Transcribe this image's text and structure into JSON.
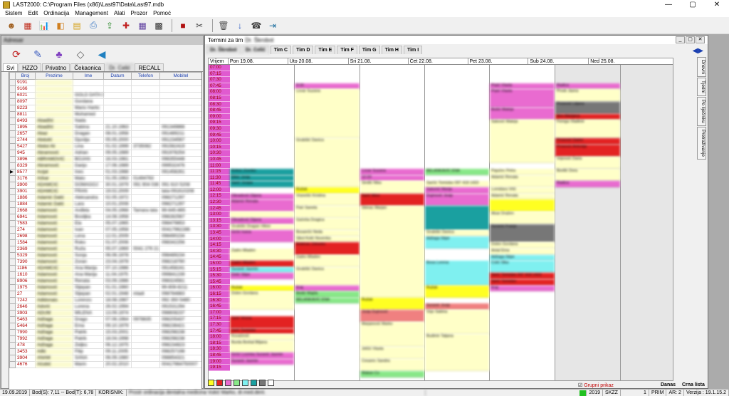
{
  "window": {
    "title": "LAST2000: C:\\Program Files (x86)\\Last97\\Data\\Last97.mdb",
    "min": "—",
    "max": "▢",
    "close": "✕"
  },
  "menu": [
    "Sistem",
    "Edit",
    "Ordinacija",
    "Management",
    "Alati",
    "Prozor",
    "Pomoć"
  ],
  "left": {
    "title": "Adresar",
    "tabs": [
      "Svi",
      "HZZO",
      "Privatno",
      "Čekaonica",
      "Dr. Celić",
      "RECALL"
    ],
    "columns": [
      "Broj",
      "Prezime",
      "Ime",
      "Datum",
      "Telefon",
      "Mobitel"
    ],
    "rows": [
      [
        "9191",
        "",
        "",
        "",
        "",
        ""
      ],
      [
        "9166",
        "",
        "",
        "",
        "",
        ""
      ],
      [
        "6021",
        "",
        "GOLD DATA D",
        "",
        "",
        ""
      ],
      [
        "8097",
        "",
        "Gordana",
        "",
        "",
        ""
      ],
      [
        "8223",
        "",
        "Mario Hartic",
        "",
        "",
        ""
      ],
      [
        "8811",
        "",
        "Muhamed",
        "",
        "",
        ""
      ],
      [
        "8493",
        "Abadžić",
        "Nada",
        "",
        "",
        ""
      ],
      [
        "1895",
        "Abadžić",
        "Sabina",
        "21.10.1963",
        "",
        "091349866"
      ],
      [
        "2657",
        "Abaz",
        "Dragan",
        "08.01.1958",
        "",
        "091489211"
      ],
      [
        "2744",
        "Abdulić",
        "Djurdja",
        "05.05.2000",
        "",
        "091234567"
      ],
      [
        "5427",
        "Abdul Ali",
        "Lina",
        "01.02.1999",
        "3735082",
        "091562419"
      ],
      [
        "945",
        "Abramović",
        "Adrian",
        "09.05.1989",
        "",
        "091978254"
      ],
      [
        "3896",
        "ABRAMOVIĆ",
        "BOJAN",
        "16.03.1981",
        "",
        "098355448"
      ],
      [
        "8329",
        "Abramović",
        "Darijo",
        "17.06.1989",
        "",
        "099532476"
      ],
      [
        "8577",
        "Acijal",
        "Ines",
        "01.03.1988",
        "",
        "091458261"
      ],
      [
        "3176",
        "Ačkar",
        "Mato",
        "01.05.1963",
        "01494763",
        ""
      ],
      [
        "3900",
        "ADAMČIĆ",
        "DOMAGOJ",
        "30.01.1979",
        "091 904 036",
        "091 610 5208"
      ],
      [
        "3901",
        "ADAMČIĆ",
        "FRAN",
        "19.02.2009",
        "",
        "tata-091610208"
      ],
      [
        "1886",
        "Adamić Dalić",
        "Aleksandra",
        "02.05.1972",
        "",
        "098271297"
      ],
      [
        "1884",
        "Adamić Dalić",
        "Lara",
        "10.01.2008",
        "",
        "098271297"
      ],
      [
        "2668",
        "Adamović",
        "Anđela",
        "04.05.1968",
        "Tamara tata",
        "99-645-865"
      ],
      [
        "6941",
        "Adamović",
        "Bosiljka",
        "14.08.1958",
        "",
        "098282567"
      ],
      [
        "7583",
        "Adamović",
        "Ela",
        "05.07.1965",
        "",
        "098479853"
      ],
      [
        "274",
        "Adamović",
        "Ivan",
        "07.05.1958",
        "",
        "00417962286"
      ],
      [
        "2698",
        "Adamović",
        "Lena",
        "12.01.2009",
        "",
        "098490234"
      ],
      [
        "1584",
        "Adamović",
        "Roko",
        "01.07.2006",
        "",
        "098342256"
      ],
      [
        "2369",
        "Adamović",
        "Ruža",
        "05.07.1969",
        "0041 279 21",
        ""
      ],
      [
        "5329",
        "Adamović",
        "Sonja",
        "06.06.1978",
        "",
        "098489234"
      ],
      [
        "7390",
        "Adamović",
        "Zoran",
        "23.04.1978",
        "",
        "098218790"
      ],
      [
        "1186",
        "ADAMČIĆ",
        "Ana Marija",
        "07.10.1986",
        "",
        "091458241"
      ],
      [
        "1610",
        "Adamović",
        "Ana Marija",
        "11.04.1975",
        "",
        "099841239"
      ],
      [
        "8906",
        "Adamović",
        "Renata",
        "03.09.1986",
        "",
        "098324561"
      ],
      [
        "1975",
        "Adamović",
        "Stjepan",
        "01.01.1960",
        "",
        "99-808-8211"
      ],
      [
        "27",
        "Adamović",
        "Stjepan",
        "02.01.1948",
        "mladi",
        "098784883"
      ],
      [
        "7242",
        "Adldonaio",
        "Lorenzo",
        "18.08.1987",
        "",
        "092 350 5480"
      ],
      [
        "2646",
        "Adorić",
        "Lorena",
        "26.02.1994",
        "",
        "091531294"
      ],
      [
        "3903",
        "ADUM",
        "MILENA",
        "13.09.1974",
        "",
        "098608237"
      ],
      [
        "5463",
        "Adžaga",
        "Drago",
        "07.06.1964",
        "0978835",
        "098205437"
      ],
      [
        "5464",
        "Adžaga",
        "Ema",
        "09.10.1979",
        "",
        "098236421"
      ],
      [
        "7990",
        "Adžaga",
        "Patrik",
        "15.03.2001",
        "",
        "098298238"
      ],
      [
        "7992",
        "Adžaga",
        "Patrik",
        "18.04.1998",
        "",
        "098298238"
      ],
      [
        "478",
        "Adžaga",
        "Željko",
        "06.12.1975",
        "",
        "098234823"
      ],
      [
        "3453",
        "Ađić",
        "Filip",
        "09.11.2005",
        "",
        "098257198"
      ],
      [
        "3904",
        "ANAM",
        "SANA",
        "06.09.1980",
        "",
        "098854321"
      ],
      [
        "4676",
        "Ačubić",
        "Marin",
        "20.02.2010",
        "",
        "00417964750007"
      ]
    ]
  },
  "right": {
    "title": "Termini za tim",
    "subtitle": "Dr. Škrobot",
    "tabs": [
      "Dr. Škrobot",
      "Dr. Celić",
      "Tim C",
      "Tim D",
      "Tim E",
      "Tim F",
      "Tim G",
      "Tim H",
      "Tim I"
    ],
    "nav": "◀▶",
    "vrijeme_label": "Vrijem",
    "days": [
      "Pon 19.08.",
      "Uto 20.08.",
      "Sri 21.08.",
      "Čet 22.08.",
      "Pet 23.08.",
      "Sub 24.08.",
      "Ned 25.08."
    ],
    "times": [
      "07:00",
      "07:15",
      "07:30",
      "07:45",
      "08:00",
      "08:15",
      "08:30",
      "08:45",
      "09:00",
      "09:15",
      "09:30",
      "09:45",
      "10:00",
      "10:15",
      "10:30",
      "10:45",
      "11:00",
      "11:15",
      "11:30",
      "11:45",
      "12:00",
      "12:15",
      "12:30",
      "12:45",
      "13:00",
      "13:15",
      "13:30",
      "13:45",
      "14:00",
      "14:15",
      "14:30",
      "14:45",
      "15:00",
      "15:15",
      "15:30",
      "15:45",
      "16:00",
      "16:15",
      "16:30",
      "16:45",
      "17:00",
      "17:15",
      "17:30",
      "17:45",
      "18:00",
      "18:15",
      "18:30",
      "18:45",
      "19:00",
      "19:15"
    ],
    "appointments": [
      [
        {
          "t": "Kekez Zvonko",
          "s": 17,
          "d": 1,
          "c": "#1aa0a0"
        },
        {
          "t": "Đikić Josip",
          "s": 18,
          "d": 1,
          "c": "#1aa0a0"
        },
        {
          "t": "Šarić Josipa",
          "s": 19,
          "d": 1,
          "c": "#1aa0a0"
        },
        {
          "t": "Obradović Dijana",
          "s": 21,
          "d": 1,
          "c": "#e96bd0"
        },
        {
          "t": "Adamić Renata",
          "s": 22,
          "d": 2,
          "c": "#e96bd0"
        },
        {
          "t": "",
          "s": 24,
          "d": 1,
          "c": "#ffffc8"
        },
        {
          "t": "Obradović Dijana",
          "s": 25,
          "d": 1,
          "c": "#e96bd0"
        },
        {
          "t": "Grubišić Dragan Viktor",
          "s": 26,
          "d": 1,
          "c": "#ffffc8"
        },
        {
          "t": "Grčić Ivana",
          "s": 27,
          "d": 2,
          "c": "#e96bd0"
        },
        {
          "t": "Zadro Mladen",
          "s": 30,
          "d": 2,
          "c": "#ffffc8"
        },
        {
          "t": "Zadro Mladen",
          "s": 32,
          "d": 1,
          "c": "#e32222"
        },
        {
          "t": "Šuranić Jasmin",
          "s": 33,
          "d": 1,
          "c": "#7ff0f0"
        },
        {
          "t": "Delić Stipe",
          "s": 34,
          "d": 1,
          "c": "#e96bd0"
        },
        {
          "t": "Ružak",
          "s": 36,
          "d": 1,
          "c": "#ffff22"
        },
        {
          "t": "Dolen Gordana",
          "s": 37,
          "d": 3,
          "c": "#ffffc8"
        },
        {
          "t": "Jurić Vesna",
          "s": 41,
          "d": 2,
          "c": "#e32222"
        },
        {
          "t": "Jurić Tomislav",
          "s": 43,
          "d": 1,
          "c": "#e32222"
        },
        {
          "t": "Kovačević",
          "s": 44,
          "d": 1,
          "c": "#ffffc8"
        },
        {
          "t": "Burda Borbal Biljana",
          "s": 45,
          "d": 2,
          "c": "#ffffc8"
        },
        {
          "t": "Grčić Lozinka Šuranić Jasmin",
          "s": 47,
          "d": 1,
          "c": "#e96bd0"
        },
        {
          "t": "Šuranić Jasmin",
          "s": 48,
          "d": 1,
          "c": "#e96bd0"
        }
      ],
      [
        {
          "t": "9:16",
          "s": 3,
          "d": 1,
          "c": "#e96bd0"
        },
        {
          "t": "Lovar Suzana",
          "s": 4,
          "d": 8,
          "c": "#ffffc8"
        },
        {
          "t": "Grubišić Danica",
          "s": 12,
          "d": 8,
          "c": "#ffffc8"
        },
        {
          "t": "Ružak",
          "s": 20,
          "d": 1,
          "c": "#ffff22"
        },
        {
          "t": "Vranešić Kristina",
          "s": 21,
          "d": 2,
          "c": "#ffffc8"
        },
        {
          "t": "Paić Sanela",
          "s": 23,
          "d": 2,
          "c": "#ffffc8"
        },
        {
          "t": "Gačeša Dragica",
          "s": 25,
          "d": 2,
          "c": "#ffffc8"
        },
        {
          "t": "Bosančić Neda",
          "s": 27,
          "d": 1,
          "c": "#ffffc8"
        },
        {
          "t": "Sikol Kolić Novenka",
          "s": 28,
          "d": 1,
          "c": "#ffffc8"
        },
        {
          "t": "Bobinac Zdravko",
          "s": 29,
          "d": 2,
          "c": "#e32222"
        },
        {
          "t": "Zadro Mladen",
          "s": 31,
          "d": 2,
          "c": "#ffffc8"
        },
        {
          "t": "Grubišić Danica",
          "s": 33,
          "d": 3,
          "c": "#ffffc8"
        },
        {
          "t": "Kraj",
          "s": 36,
          "d": 1,
          "c": "#e96bd0"
        },
        {
          "t": "Bedić Majda",
          "s": 37,
          "d": 1,
          "c": "#88e888"
        },
        {
          "t": "BELANKAVIĆ ENA",
          "s": 38,
          "d": 1,
          "c": "#88e888"
        }
      ],
      [
        {
          "t": "Lovar Suzana",
          "s": 17,
          "d": 1,
          "c": "#e96bd0"
        },
        {
          "t": "12:20",
          "s": 18,
          "d": 1,
          "c": "#e96bd0"
        },
        {
          "t": "Sinđić Nika",
          "s": 19,
          "d": 2,
          "c": "#ffffc8"
        },
        {
          "t": "Šarić Miso",
          "s": 21,
          "d": 2,
          "c": "#e32222"
        },
        {
          "t": "Štimac Marjan",
          "s": 23,
          "d": 15,
          "c": "#ffffc8"
        },
        {
          "t": "Ružak",
          "s": 38,
          "d": 2,
          "c": "#ffff22"
        },
        {
          "t": "Josip Dujmović",
          "s": 40,
          "d": 2,
          "c": "#f08080"
        },
        {
          "t": "Marjanović Marko",
          "s": 42,
          "d": 4,
          "c": "#ffffc8"
        },
        {
          "t": "Jelčić Vlasta",
          "s": 46,
          "d": 2,
          "c": "#ffffc8"
        },
        {
          "t": "Cesarec Sandra",
          "s": 48,
          "d": 2,
          "c": "#ffffc8"
        },
        {
          "t": "Makan Cs",
          "s": 50,
          "d": 1,
          "c": "#88e888"
        }
      ],
      [
        {
          "t": "BELANKAVIĆ ENA",
          "s": 17,
          "d": 1,
          "c": "#88e888"
        },
        {
          "t": "Šarčić Tomislav 097 418 1433",
          "s": 19,
          "d": 1,
          "c": "#ffffc8"
        },
        {
          "t": "Šakonić Marija",
          "s": 20,
          "d": 1,
          "c": "#e96bd0"
        },
        {
          "t": "Dujmović Josip",
          "s": 21,
          "d": 2,
          "c": "#e96bd0"
        },
        {
          "t": "",
          "s": 23,
          "d": 4,
          "c": "#1aa0a0"
        },
        {
          "t": "Grubišić Danica",
          "s": 27,
          "d": 1,
          "c": "#ffffc8"
        },
        {
          "t": "Adžaga Stipe",
          "s": 28,
          "d": 2,
          "c": "#7ff0f0"
        },
        {
          "t": "Bosa Lorena",
          "s": 32,
          "d": 4,
          "c": "#7ff0f0"
        },
        {
          "t": "Ružak",
          "s": 36,
          "d": 2,
          "c": "#ffff22"
        },
        {
          "t": "Šuranić Josip",
          "s": 39,
          "d": 1,
          "c": "#f08080"
        },
        {
          "t": "Vojo Sabina",
          "s": 40,
          "d": 4,
          "c": "#ffffc8"
        },
        {
          "t": "Budimir Tatjana",
          "s": 44,
          "d": 6,
          "c": "#ffffc8"
        }
      ],
      [
        {
          "t": "Prpić Vlasta",
          "s": 3,
          "d": 1,
          "c": "#e96bd0"
        },
        {
          "t": "Prpić Vlasta",
          "s": 4,
          "d": 3,
          "c": "#e96bd0"
        },
        {
          "t": "Božić Mateja",
          "s": 7,
          "d": 2,
          "c": "#e96bd0"
        },
        {
          "t": "Šaković Mateja",
          "s": 9,
          "d": 7,
          "c": "#ffffc8"
        },
        {
          "t": "Pajučec Petra",
          "s": 17,
          "d": 1,
          "c": "#ffffc8"
        },
        {
          "t": "Adamić Renata",
          "s": 18,
          "d": 2,
          "c": "#ffffc8"
        },
        {
          "t": "Lomidara Vrlić",
          "s": 20,
          "d": 1,
          "c": "#ffffc8"
        },
        {
          "t": "Adamić Renata",
          "s": 21,
          "d": 1,
          "c": "#ffffc8"
        },
        {
          "t": "",
          "s": 22,
          "d": 2,
          "c": "#ffff22"
        },
        {
          "t": "Alsar Dražen",
          "s": 24,
          "d": 2,
          "c": "#ffffc8"
        },
        {
          "t": "Šuranić Franjo",
          "s": 26,
          "d": 3,
          "c": "#777777"
        },
        {
          "t": "Dolen Gordana",
          "s": 29,
          "d": 1,
          "c": "#ffffc8"
        },
        {
          "t": "Antal Ema",
          "s": 30,
          "d": 1,
          "c": "#ffffc8"
        },
        {
          "t": "Adžaga Stipe",
          "s": 31,
          "d": 1,
          "c": "#7ff0f0"
        },
        {
          "t": "Čolić Slka",
          "s": 32,
          "d": 2,
          "c": "#7ff0f0"
        },
        {
          "t": "Šarić Tomislav 097 418 1433",
          "s": 34,
          "d": 1,
          "c": "#e32222"
        },
        {
          "t": "Šarić Tomislav",
          "s": 35,
          "d": 1,
          "c": "#e32222"
        },
        {
          "t": "Kraj",
          "s": 36,
          "d": 1,
          "c": "#e96bd0"
        }
      ],
      [
        {
          "t": "Radica",
          "s": 3,
          "d": 1,
          "c": "#e96bd0"
        },
        {
          "t": "Prosk Jasna",
          "s": 4,
          "d": 2,
          "c": "#ffffc8"
        },
        {
          "t": "Prosović Liljana",
          "s": 6,
          "d": 2,
          "c": "#777777"
        },
        {
          "t": "Biro Marijana",
          "s": 8,
          "d": 1,
          "c": "#e32222"
        },
        {
          "t": "Ferega Vladimir",
          "s": 9,
          "d": 3,
          "c": "#ffffc8"
        },
        {
          "t": "Prosović Darko",
          "s": 12,
          "d": 1,
          "c": "#e32222"
        },
        {
          "t": "Prosović Antonija",
          "s": 13,
          "d": 2,
          "c": "#e32222"
        },
        {
          "t": "Vojnović Daria",
          "s": 15,
          "d": 2,
          "c": "#ffffc8"
        },
        {
          "t": "Borđić Dora",
          "s": 17,
          "d": 2,
          "c": "#ffffc8"
        },
        {
          "t": "Radica",
          "s": 19,
          "d": 1,
          "c": "#e96bd0"
        }
      ],
      []
    ],
    "side_tabs": [
      "Dnevni",
      "Tjedni",
      "Po liječniku",
      "Pretraživanje"
    ],
    "swatches": [
      "#ffff22",
      "#e32222",
      "#e96bd0",
      "#88e888",
      "#7ff0f0",
      "#1aa0a0",
      "#777777",
      "#ffffff"
    ],
    "grupni": "Grupni prikaz",
    "danas": "Danas",
    "crna_lista": "Crna lista"
  },
  "status": {
    "date": "19.09.2019",
    "bod": "Bod(S): 7,11 -- Bod(T): 6,78",
    "korisnik": "KORISNIK:",
    "user_text": "Prostr ordinacija dentalna medicina Vukić Marko, dr.med.dent.",
    "year": "2019",
    "skzz": "SKZZ",
    "num": "1",
    "prim": "PRIM",
    "ar": "AR: 2",
    "verzija": "Verzija : 19.1.15.2"
  }
}
